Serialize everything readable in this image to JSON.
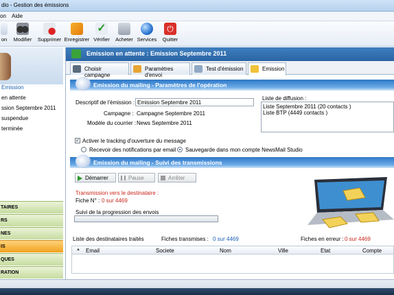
{
  "window": {
    "title": "dio - Gestion des émissions"
  },
  "menu": {
    "items": [
      "on",
      "Aide"
    ]
  },
  "toolbar": {
    "buttons": [
      {
        "label": "on",
        "icon": "new-icon"
      },
      {
        "label": "Modifier",
        "icon": "modify-icon"
      },
      {
        "label": "Supprimer",
        "icon": "delete-icon"
      },
      {
        "label": "Enregistrer",
        "icon": "save-icon"
      },
      {
        "label": "Vérifier",
        "icon": "check-icon"
      },
      {
        "label": "Acheter",
        "icon": "cart-icon"
      },
      {
        "label": "Services",
        "icon": "globe-icon"
      },
      {
        "label": "Quitter",
        "icon": "power-icon"
      }
    ]
  },
  "sidebar": {
    "items": [
      "Emission",
      "en attente",
      "ssion Septembre 2011",
      "suspendue",
      "terminée"
    ],
    "groups": [
      "TAIRES",
      "RS",
      "NES",
      "IS",
      "QUES",
      "RATION"
    ]
  },
  "main": {
    "header": "Emission en attente : Emission Septembre 2011",
    "tabs": [
      "Choisir campagne",
      "Paramètres d'envoi",
      "Test d'émission",
      "Emission"
    ]
  },
  "params": {
    "section_title": "Emission du mailing - Paramètres de l'opération",
    "desc_label": "Descriptif de l'émission :",
    "desc_value": "Emission Septembre 2011",
    "campaign_label": "Campagne :",
    "campaign_value": "Campagne Septembre 2011",
    "model_label": "Modèle du courrier :",
    "model_value": "News Septembre 2011",
    "list_label": "Liste de diffusion :",
    "lists": [
      "Liste Septembre 2011  (20 contacts )",
      "Liste BTP  (4449 contacts )"
    ],
    "tracking_label": "Activer le tracking d'ouverture du message",
    "radio_email": "Recevoir des notifications par email",
    "radio_save": "Sauvegarde dans mon compte NewsMail Studio"
  },
  "transmissions": {
    "section_title": "Emission du mailing - Suivi des transmissions",
    "btn_start": "Démarrer",
    "btn_pause": "Pause",
    "btn_stop": "Arrêter",
    "to_label": "Transmission vers le destinataire :",
    "fiche_label": "Fiche N° :",
    "fiche_value": "0 sur 4469",
    "progress_label": "Suivi de la progression des envois",
    "progress_value": 0
  },
  "recipients": {
    "list_label": "Liste des destinataires traités",
    "sent_label": "Fiches transmises :",
    "sent_value": "0 sur 4469",
    "errors_label": "Fiches en erreur :",
    "errors_value": "0 sur 4469",
    "columns": [
      "Email",
      "Societe",
      "Nom",
      "Ville",
      "Etat",
      "Compte rendu"
    ]
  },
  "colors": {
    "accent": "#2a64a4",
    "error": "#c8261b",
    "link": "#1a5fb4",
    "group": "#c7dca0",
    "group_active": "#f0a21f"
  }
}
